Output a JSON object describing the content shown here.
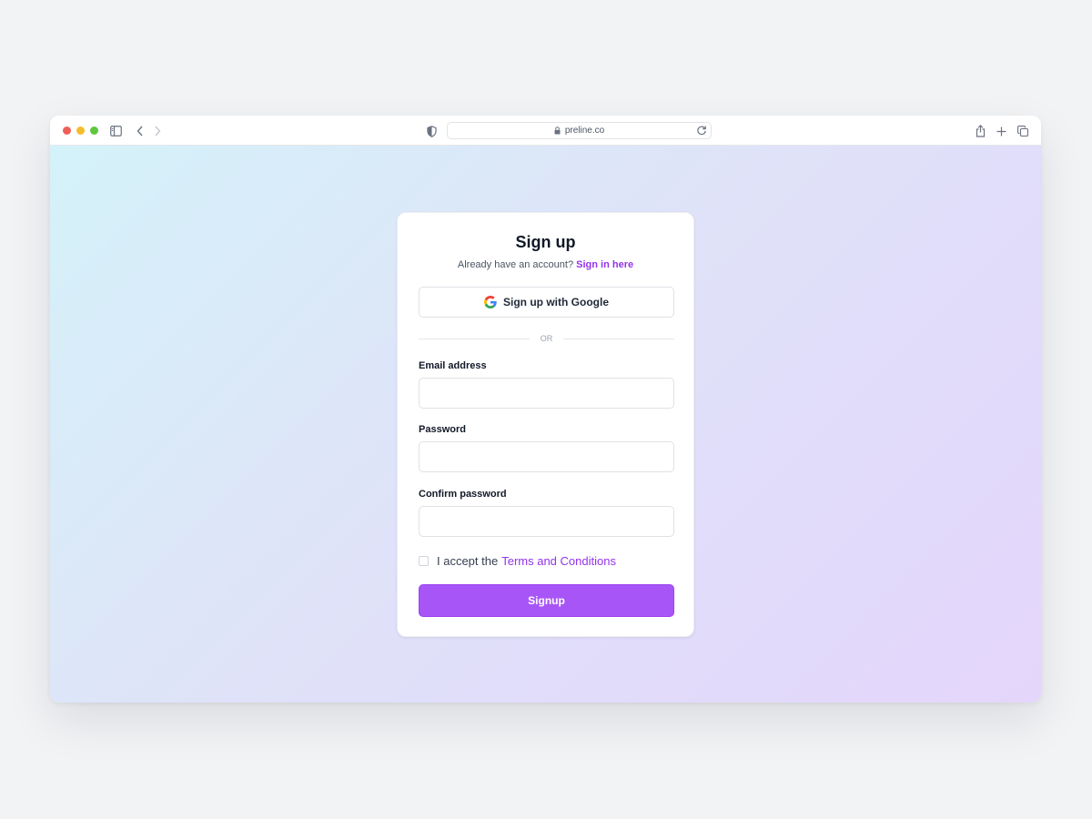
{
  "browser": {
    "url": "preline.co",
    "icons": [
      "sidebar-icon",
      "back-icon",
      "forward-icon",
      "shield-icon",
      "lock-icon",
      "reload-icon",
      "share-icon",
      "new-tab-icon",
      "tabs-icon"
    ]
  },
  "signup": {
    "title": "Sign up",
    "subtitle_prefix": "Already have an account?",
    "signin_link": "Sign in here",
    "google_button": "Sign up with Google",
    "divider": "OR",
    "email_label": "Email address",
    "email_value": "",
    "password_label": "Password",
    "password_value": "",
    "confirm_label": "Confirm password",
    "confirm_value": "",
    "terms_prefix": "I accept the",
    "terms_link": "Terms and Conditions",
    "terms_checked": false,
    "submit_button": "Signup"
  },
  "colors": {
    "accent": "#a855f7",
    "link": "#9333ea",
    "gradient_start": "#d4f2f9",
    "gradient_end": "#e4d6fb"
  }
}
